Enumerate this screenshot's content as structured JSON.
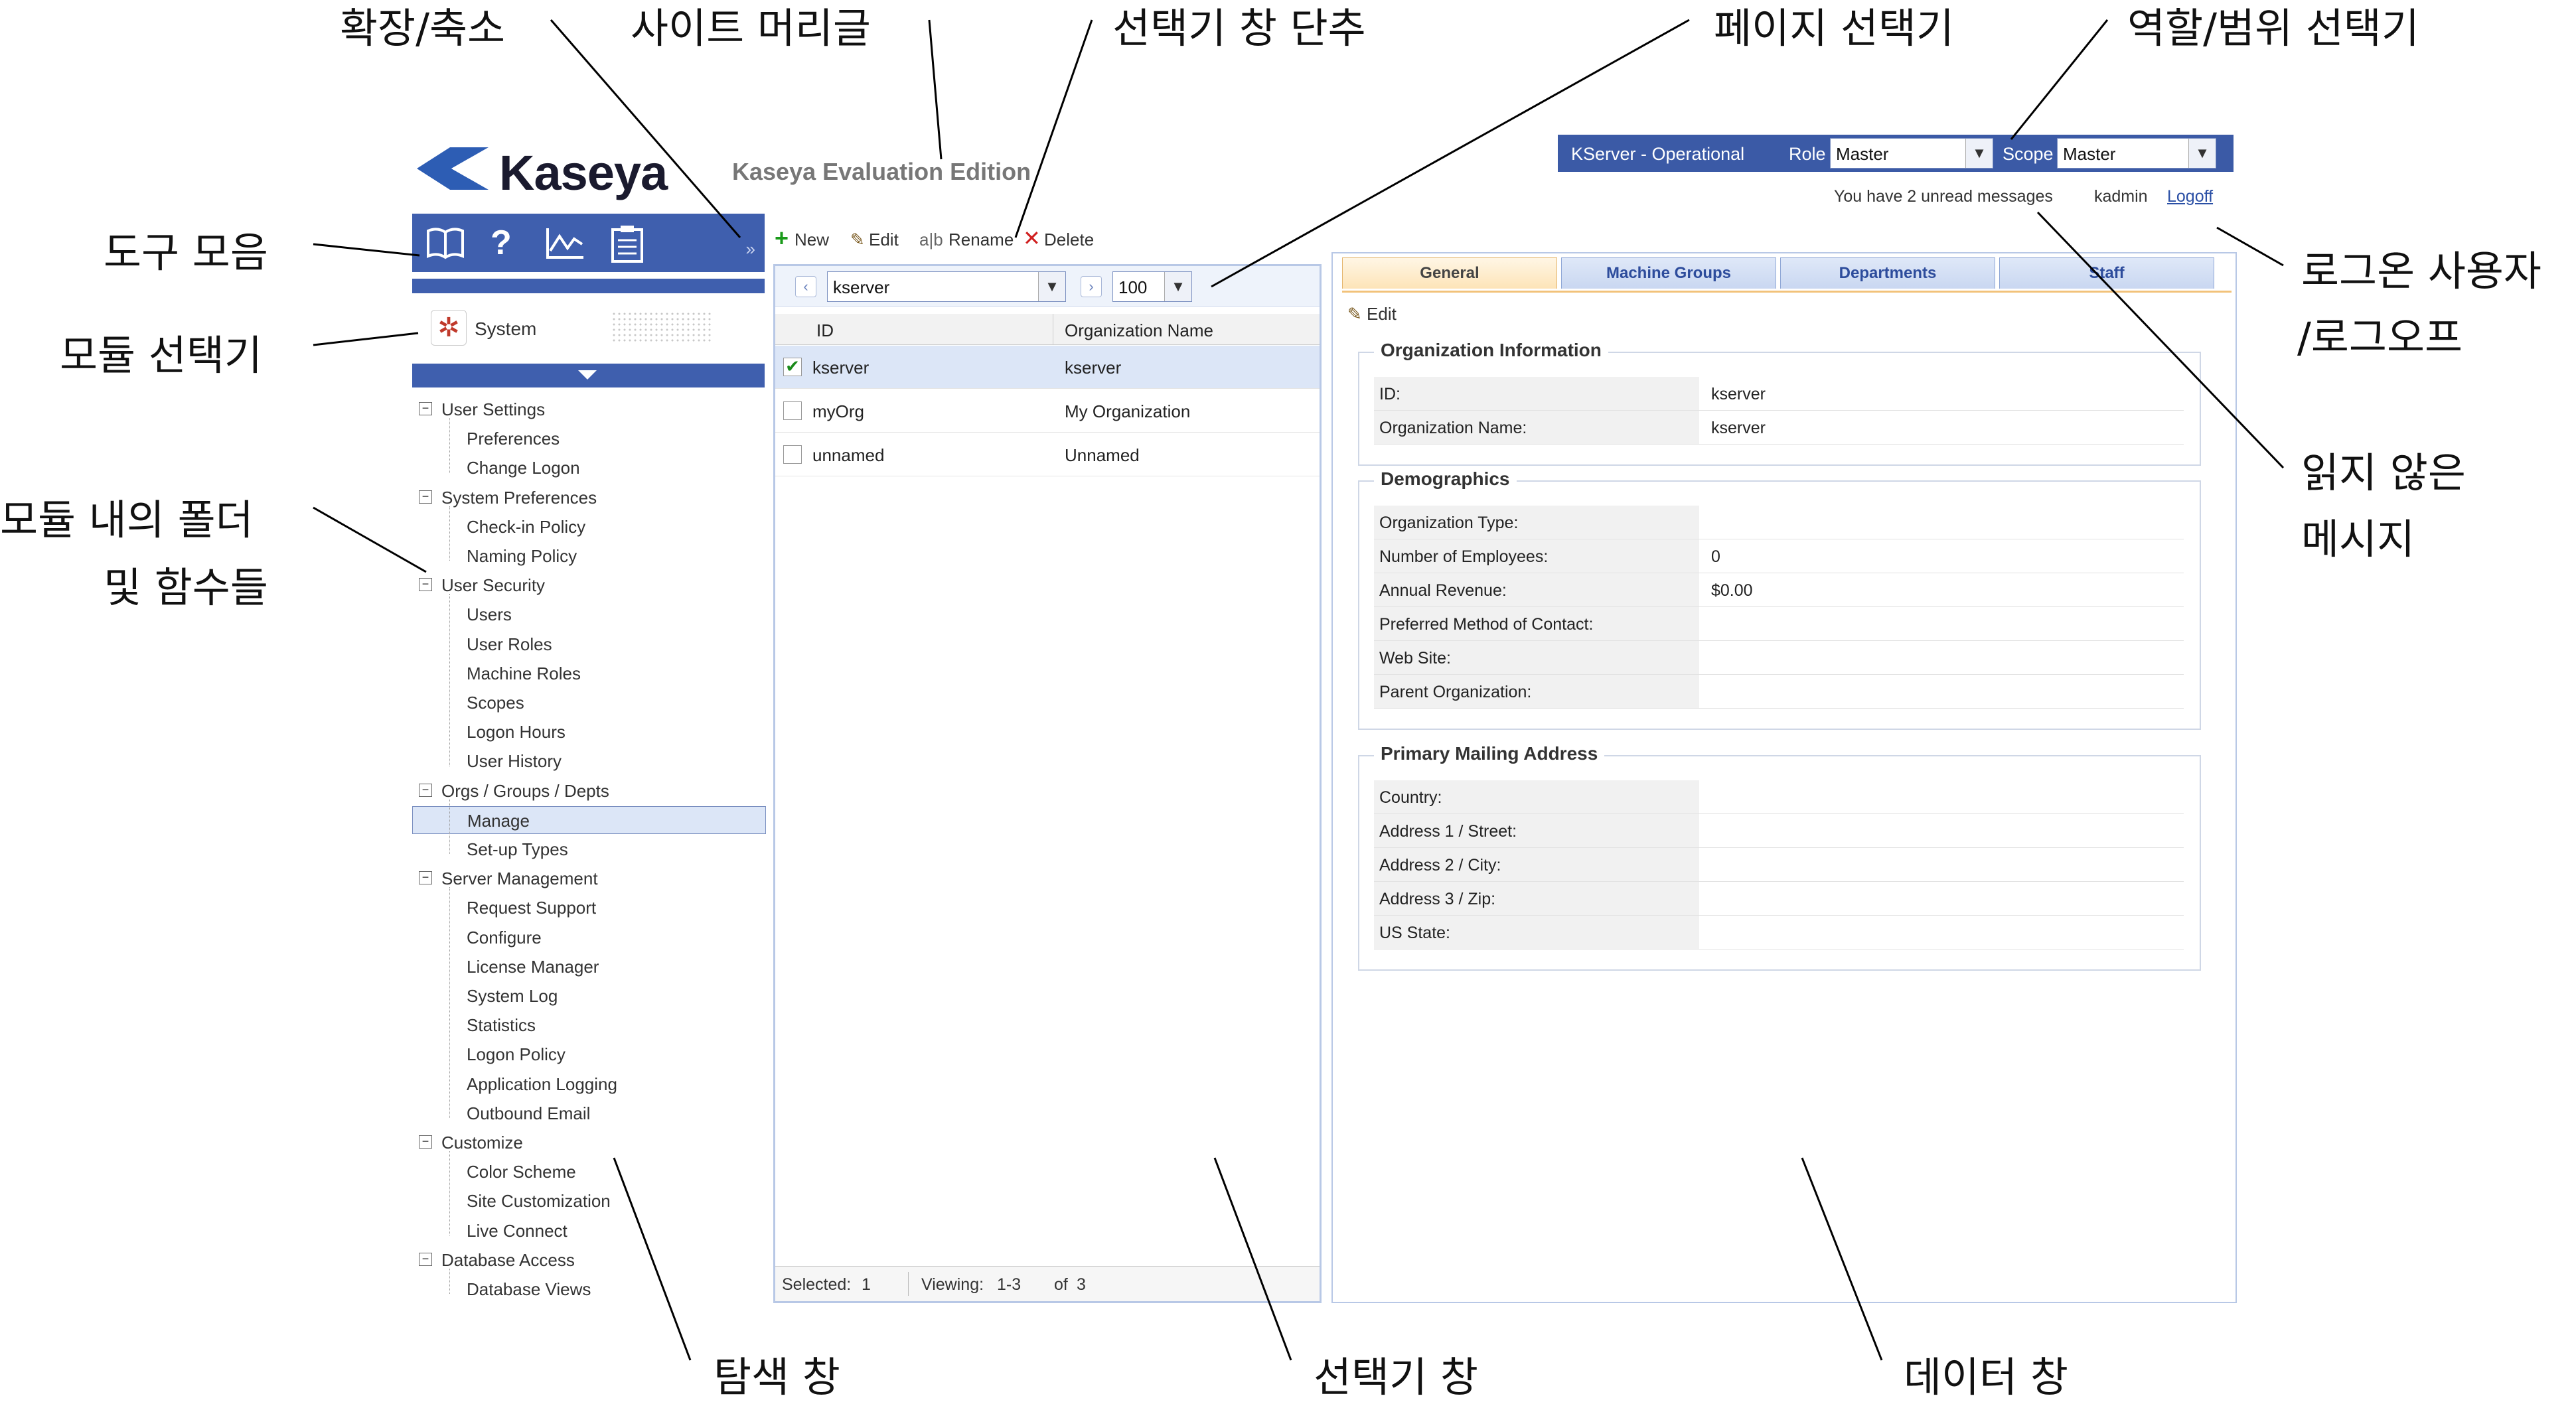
{
  "callouts": {
    "expand_collapse": "확장/축소",
    "site_header": "사이트 머리글",
    "collapse_selector": "선택기 창 단추",
    "page_selector": "페이지 선택기",
    "role_scope_selector": "역할/범위 선택기",
    "toolbox": "도구 모음",
    "module_selector": "모듈 선택기",
    "folders_line1": "모듈 내의 폴더",
    "folders_line2": "및 함수들",
    "logon_user_line1": "로그온 사용자",
    "logon_user_line2": "/로그오프",
    "unread_line1": "읽지 않은",
    "unread_line2": "메시지",
    "nav_pane": "탐색 창",
    "selector_pane": "선택기 창",
    "data_pane": "데이터 창"
  },
  "header": {
    "logo_text": "Kaseya",
    "site_header": "Kaseya Evaluation Edition",
    "server_status": "KServer - Operational",
    "role_label": "Role",
    "role_value": "Master",
    "scope_label": "Scope",
    "scope_value": "Master",
    "unread_messages": "You have 2 unread messages",
    "username": "kadmin",
    "logoff": "Logoff"
  },
  "toolbox": {
    "icons": [
      "book-icon",
      "help-icon",
      "chart-icon",
      "clipboard-icon"
    ],
    "expand_glyph": "»"
  },
  "module": {
    "name": "System"
  },
  "nav": {
    "folders": [
      {
        "label": "User Settings",
        "items": [
          "Preferences",
          "Change Logon"
        ]
      },
      {
        "label": "System Preferences",
        "items": [
          "Check-in Policy",
          "Naming Policy"
        ]
      },
      {
        "label": "User Security",
        "items": [
          "Users",
          "User Roles",
          "Machine Roles",
          "Scopes",
          "Logon Hours",
          "User History"
        ]
      },
      {
        "label": "Orgs / Groups / Depts",
        "items": [
          "Manage",
          "Set-up Types"
        ]
      },
      {
        "label": "Server Management",
        "items": [
          "Request Support",
          "Configure",
          "License Manager",
          "System Log",
          "Statistics",
          "Logon Policy",
          "Application Logging",
          "Outbound Email"
        ]
      },
      {
        "label": "Customize",
        "items": [
          "Color Scheme",
          "Site Customization",
          "Live Connect"
        ]
      },
      {
        "label": "Database Access",
        "items": [
          "Database Views"
        ]
      }
    ],
    "selected_item": "Manage"
  },
  "actions": {
    "new": "New",
    "edit": "Edit",
    "rename": "Rename",
    "delete": "Delete"
  },
  "selector": {
    "filter_value": "kserver",
    "page_size": "100",
    "columns": [
      "ID",
      "Organization Name"
    ],
    "rows": [
      {
        "id": "kserver",
        "name": "kserver",
        "checked": true
      },
      {
        "id": "myOrg",
        "name": "My Organization",
        "checked": false
      },
      {
        "id": "unnamed",
        "name": "Unnamed",
        "checked": false
      }
    ],
    "status": {
      "selected_label": "Selected:",
      "selected_value": "1",
      "viewing_label": "Viewing:",
      "viewing_value": "1-3",
      "of_label": "of",
      "total": "3"
    }
  },
  "data": {
    "tabs": [
      "General",
      "Machine Groups",
      "Departments",
      "Staff"
    ],
    "active_tab": "General",
    "edit_label": "Edit",
    "groups": [
      {
        "legend": "Organization Information",
        "fields": [
          {
            "label": "ID:",
            "value": "kserver"
          },
          {
            "label": "Organization Name:",
            "value": "kserver"
          }
        ]
      },
      {
        "legend": "Demographics",
        "fields": [
          {
            "label": "Organization Type:",
            "value": ""
          },
          {
            "label": "Number of Employees:",
            "value": "0"
          },
          {
            "label": "Annual Revenue:",
            "value": "$0.00"
          },
          {
            "label": "Preferred Method of Contact:",
            "value": ""
          },
          {
            "label": "Web Site:",
            "value": ""
          },
          {
            "label": "Parent Organization:",
            "value": ""
          }
        ]
      },
      {
        "legend": "Primary Mailing Address",
        "fields": [
          {
            "label": "Country:",
            "value": ""
          },
          {
            "label": "Address 1 / Street:",
            "value": ""
          },
          {
            "label": "Address 2 / City:",
            "value": ""
          },
          {
            "label": "Address 3 / Zip:",
            "value": ""
          },
          {
            "label": "US State:",
            "value": ""
          }
        ]
      }
    ]
  },
  "colors": {
    "brand_blue": "#3f5fae",
    "topbar_blue": "#3b5aa6",
    "selection_bg": "#dce6f7",
    "active_tab_border": "#f2c27a"
  }
}
